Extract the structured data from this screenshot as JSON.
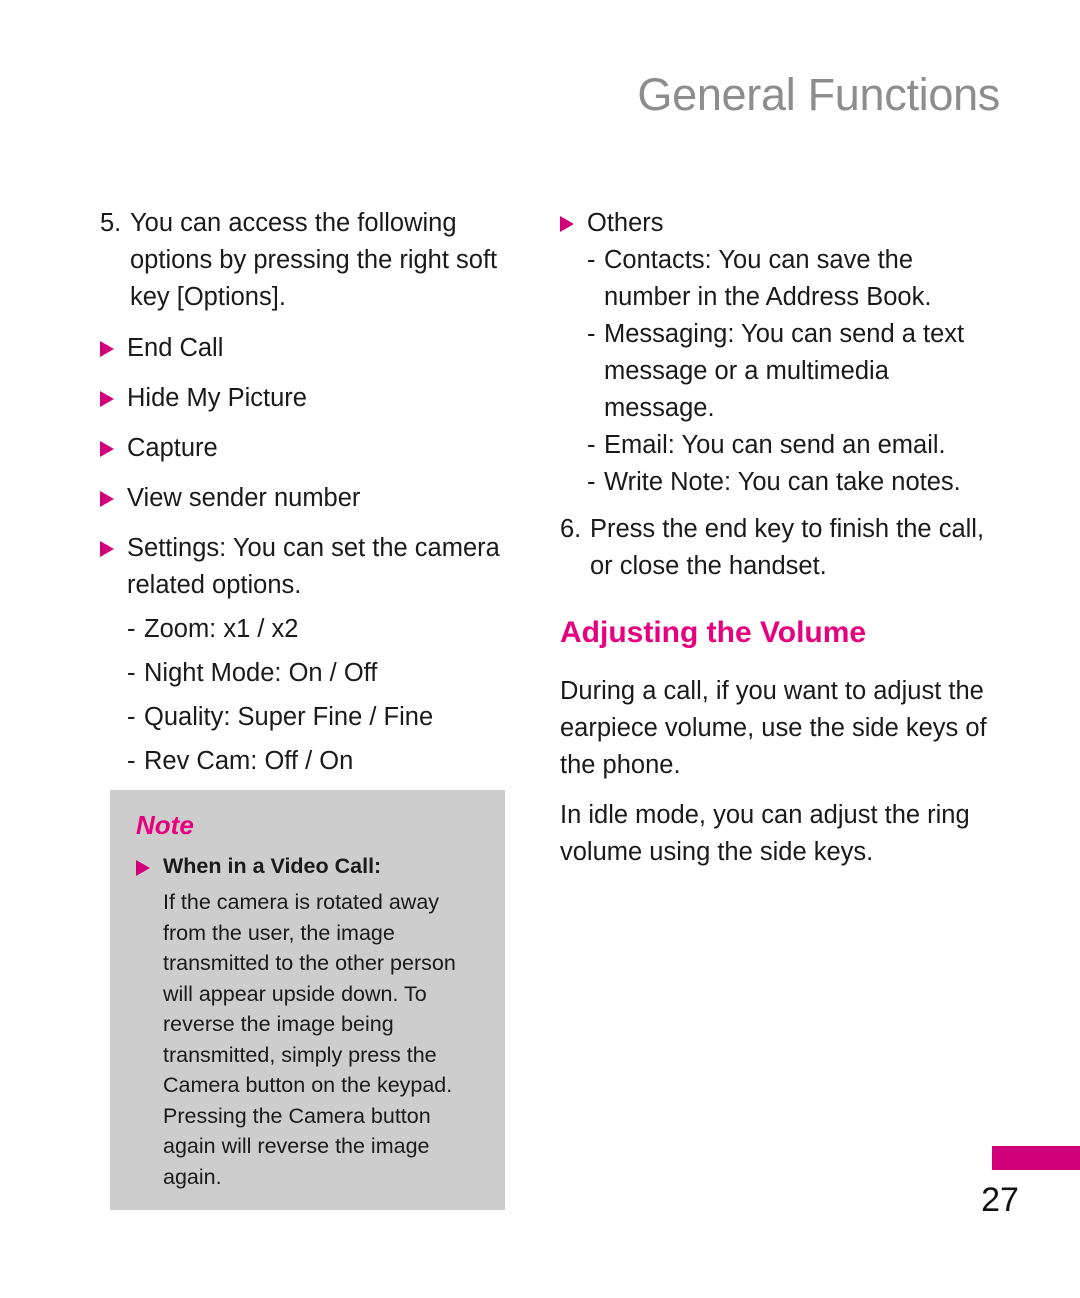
{
  "header": {
    "title": "General Functions"
  },
  "left_column": {
    "step": {
      "number": "5.",
      "text": "You can access the following options by pressing the right soft key [Options]."
    },
    "options": [
      {
        "label": "End Call"
      },
      {
        "label": "Hide My Picture"
      },
      {
        "label": "Capture"
      },
      {
        "label": "View sender number"
      },
      {
        "label": "Settings: You can set the camera related options."
      }
    ],
    "settings_sub_items": [
      {
        "dash": "-",
        "text": "Zoom: x1 / x2"
      },
      {
        "dash": "-",
        "text": "Night Mode: On / Off"
      },
      {
        "dash": "-",
        "text": "Quality: Super Fine / Fine"
      },
      {
        "dash": "-",
        "text": "Rev Cam: Off / On"
      }
    ]
  },
  "note_box": {
    "title": "Note",
    "subtitle": "When in a Video Call:",
    "body": "If the camera is rotated away from the user, the image transmitted to the other person will appear upside down. To reverse the image being transmitted, simply press the Camera button on the keypad. Pressing the Camera button again will reverse the image again."
  },
  "right_column": {
    "others_label": "Others",
    "others_sub_items": [
      {
        "dash": "-",
        "text": "Contacts: You can save the number in the Address Book."
      },
      {
        "dash": "-",
        "text": "Messaging: You can send a text message or a multimedia message."
      },
      {
        "dash": "-",
        "text": "Email: You can send an email."
      },
      {
        "dash": "-",
        "text": "Write Note: You can take notes."
      }
    ],
    "step6": {
      "number": "6.",
      "text": "Press the end key to finish the call, or close the handset."
    },
    "section_heading": "Adjusting the Volume",
    "paragraphs": [
      "During a call, if you want to adjust the earpiece volume, use the side keys of the phone.",
      "In idle mode, you can adjust the ring volume using the side keys."
    ]
  },
  "footer": {
    "page_number": "27"
  },
  "colors": {
    "accent_magenta": "#D1007A",
    "heading_magenta": "#E6007E",
    "header_gray": "#8D8D8D",
    "note_bg_gray": "#CDCDCD"
  }
}
